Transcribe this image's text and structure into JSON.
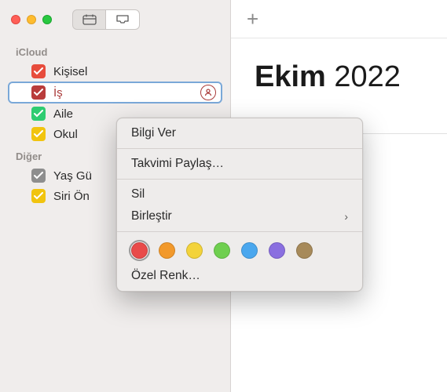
{
  "sidebar": {
    "sections": [
      {
        "header": "iCloud",
        "items": [
          {
            "label": "Kişisel",
            "color": "#e74c3c",
            "selected": false
          },
          {
            "label": "İş",
            "color": "#b93c3b",
            "selected": true
          },
          {
            "label": "Aile",
            "color": "#2ecc71",
            "selected": false
          },
          {
            "label": "Okul",
            "color": "#f1c40f",
            "selected": false
          }
        ]
      },
      {
        "header": "Diğer",
        "items": [
          {
            "label": "Yaş Gü",
            "color": "#8e8e8e",
            "selected": false
          },
          {
            "label": "Siri Ön",
            "color": "#f1c40f",
            "selected": false
          }
        ]
      }
    ]
  },
  "main": {
    "month_bold": "Ekim",
    "month_year": " 2022"
  },
  "context_menu": {
    "info": "Bilgi Ver",
    "share": "Takvimi Paylaş…",
    "delete": "Sil",
    "merge": "Birleştir",
    "custom_color": "Özel Renk…",
    "colors": [
      {
        "hex": "#e94b4a",
        "selected": true
      },
      {
        "hex": "#f2992b",
        "selected": false
      },
      {
        "hex": "#f3d33b",
        "selected": false
      },
      {
        "hex": "#6fcf4f",
        "selected": false
      },
      {
        "hex": "#4aa7ee",
        "selected": false
      },
      {
        "hex": "#8a6fe0",
        "selected": false
      },
      {
        "hex": "#a78a5a",
        "selected": false
      }
    ]
  }
}
